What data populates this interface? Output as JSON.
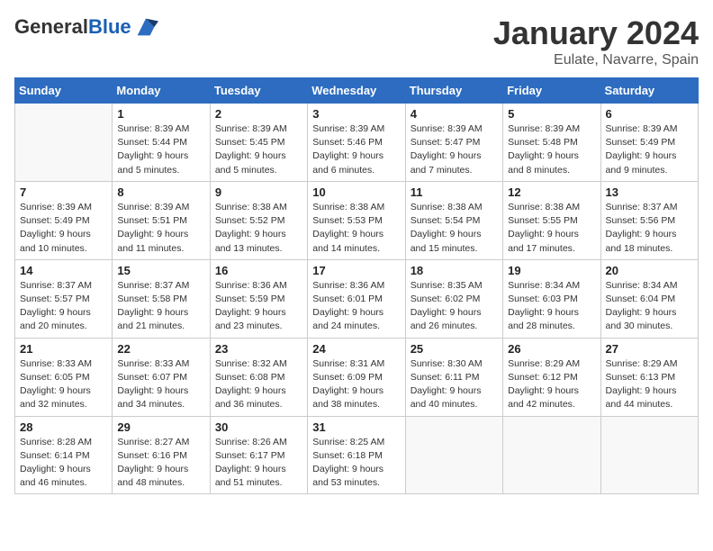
{
  "header": {
    "logo_general": "General",
    "logo_blue": "Blue",
    "month_title": "January 2024",
    "location": "Eulate, Navarre, Spain"
  },
  "days_of_week": [
    "Sunday",
    "Monday",
    "Tuesday",
    "Wednesday",
    "Thursday",
    "Friday",
    "Saturday"
  ],
  "weeks": [
    [
      {
        "day": "",
        "info": ""
      },
      {
        "day": "1",
        "info": "Sunrise: 8:39 AM\nSunset: 5:44 PM\nDaylight: 9 hours\nand 5 minutes."
      },
      {
        "day": "2",
        "info": "Sunrise: 8:39 AM\nSunset: 5:45 PM\nDaylight: 9 hours\nand 5 minutes."
      },
      {
        "day": "3",
        "info": "Sunrise: 8:39 AM\nSunset: 5:46 PM\nDaylight: 9 hours\nand 6 minutes."
      },
      {
        "day": "4",
        "info": "Sunrise: 8:39 AM\nSunset: 5:47 PM\nDaylight: 9 hours\nand 7 minutes."
      },
      {
        "day": "5",
        "info": "Sunrise: 8:39 AM\nSunset: 5:48 PM\nDaylight: 9 hours\nand 8 minutes."
      },
      {
        "day": "6",
        "info": "Sunrise: 8:39 AM\nSunset: 5:49 PM\nDaylight: 9 hours\nand 9 minutes."
      }
    ],
    [
      {
        "day": "7",
        "info": "Sunrise: 8:39 AM\nSunset: 5:49 PM\nDaylight: 9 hours\nand 10 minutes."
      },
      {
        "day": "8",
        "info": "Sunrise: 8:39 AM\nSunset: 5:51 PM\nDaylight: 9 hours\nand 11 minutes."
      },
      {
        "day": "9",
        "info": "Sunrise: 8:38 AM\nSunset: 5:52 PM\nDaylight: 9 hours\nand 13 minutes."
      },
      {
        "day": "10",
        "info": "Sunrise: 8:38 AM\nSunset: 5:53 PM\nDaylight: 9 hours\nand 14 minutes."
      },
      {
        "day": "11",
        "info": "Sunrise: 8:38 AM\nSunset: 5:54 PM\nDaylight: 9 hours\nand 15 minutes."
      },
      {
        "day": "12",
        "info": "Sunrise: 8:38 AM\nSunset: 5:55 PM\nDaylight: 9 hours\nand 17 minutes."
      },
      {
        "day": "13",
        "info": "Sunrise: 8:37 AM\nSunset: 5:56 PM\nDaylight: 9 hours\nand 18 minutes."
      }
    ],
    [
      {
        "day": "14",
        "info": "Sunrise: 8:37 AM\nSunset: 5:57 PM\nDaylight: 9 hours\nand 20 minutes."
      },
      {
        "day": "15",
        "info": "Sunrise: 8:37 AM\nSunset: 5:58 PM\nDaylight: 9 hours\nand 21 minutes."
      },
      {
        "day": "16",
        "info": "Sunrise: 8:36 AM\nSunset: 5:59 PM\nDaylight: 9 hours\nand 23 minutes."
      },
      {
        "day": "17",
        "info": "Sunrise: 8:36 AM\nSunset: 6:01 PM\nDaylight: 9 hours\nand 24 minutes."
      },
      {
        "day": "18",
        "info": "Sunrise: 8:35 AM\nSunset: 6:02 PM\nDaylight: 9 hours\nand 26 minutes."
      },
      {
        "day": "19",
        "info": "Sunrise: 8:34 AM\nSunset: 6:03 PM\nDaylight: 9 hours\nand 28 minutes."
      },
      {
        "day": "20",
        "info": "Sunrise: 8:34 AM\nSunset: 6:04 PM\nDaylight: 9 hours\nand 30 minutes."
      }
    ],
    [
      {
        "day": "21",
        "info": "Sunrise: 8:33 AM\nSunset: 6:05 PM\nDaylight: 9 hours\nand 32 minutes."
      },
      {
        "day": "22",
        "info": "Sunrise: 8:33 AM\nSunset: 6:07 PM\nDaylight: 9 hours\nand 34 minutes."
      },
      {
        "day": "23",
        "info": "Sunrise: 8:32 AM\nSunset: 6:08 PM\nDaylight: 9 hours\nand 36 minutes."
      },
      {
        "day": "24",
        "info": "Sunrise: 8:31 AM\nSunset: 6:09 PM\nDaylight: 9 hours\nand 38 minutes."
      },
      {
        "day": "25",
        "info": "Sunrise: 8:30 AM\nSunset: 6:11 PM\nDaylight: 9 hours\nand 40 minutes."
      },
      {
        "day": "26",
        "info": "Sunrise: 8:29 AM\nSunset: 6:12 PM\nDaylight: 9 hours\nand 42 minutes."
      },
      {
        "day": "27",
        "info": "Sunrise: 8:29 AM\nSunset: 6:13 PM\nDaylight: 9 hours\nand 44 minutes."
      }
    ],
    [
      {
        "day": "28",
        "info": "Sunrise: 8:28 AM\nSunset: 6:14 PM\nDaylight: 9 hours\nand 46 minutes."
      },
      {
        "day": "29",
        "info": "Sunrise: 8:27 AM\nSunset: 6:16 PM\nDaylight: 9 hours\nand 48 minutes."
      },
      {
        "day": "30",
        "info": "Sunrise: 8:26 AM\nSunset: 6:17 PM\nDaylight: 9 hours\nand 51 minutes."
      },
      {
        "day": "31",
        "info": "Sunrise: 8:25 AM\nSunset: 6:18 PM\nDaylight: 9 hours\nand 53 minutes."
      },
      {
        "day": "",
        "info": ""
      },
      {
        "day": "",
        "info": ""
      },
      {
        "day": "",
        "info": ""
      }
    ]
  ]
}
